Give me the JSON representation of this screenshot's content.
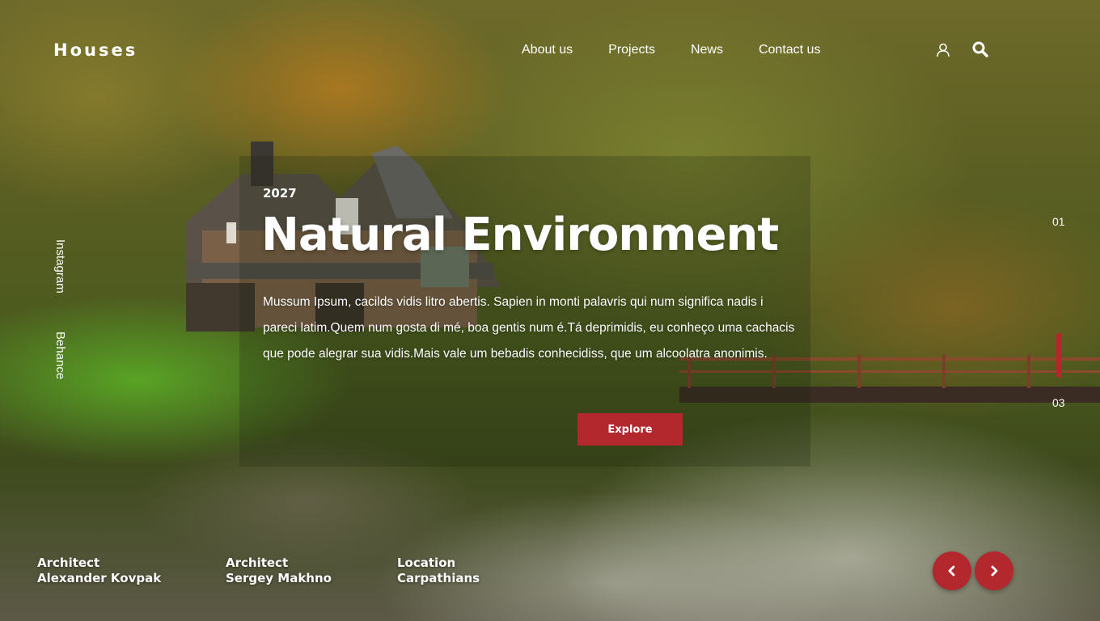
{
  "header": {
    "logo": "Houses",
    "nav": [
      "About us",
      "Projects",
      "News",
      "Contact us"
    ],
    "icons": [
      "user-icon",
      "search-icon"
    ]
  },
  "social": {
    "instagram": "Instagram",
    "behance": "Behance"
  },
  "hero": {
    "year": "2027",
    "title": "Natural Environment",
    "description": "Mussum Ipsum, cacilds vidis litro abertis. Sapien in monti palavris qui num significa nadis i pareci latim.Quem num gosta di mé, boa gentis num é.Tá deprimidis, eu conheço uma cachacis que pode alegrar sua vidis.Mais vale um bebadis conhecidiss, que um alcoolatra anonimis.",
    "button": "Explore"
  },
  "slider": {
    "first": "01",
    "last": "03"
  },
  "credits": [
    {
      "role": "Architect",
      "name": "Alexander Kovpak"
    },
    {
      "role": "Architect",
      "name": "Sergey Makhno"
    },
    {
      "role": "Location",
      "name": "Carpathians"
    }
  ],
  "colors": {
    "accent": "#b3282c",
    "text": "#ffffff"
  }
}
